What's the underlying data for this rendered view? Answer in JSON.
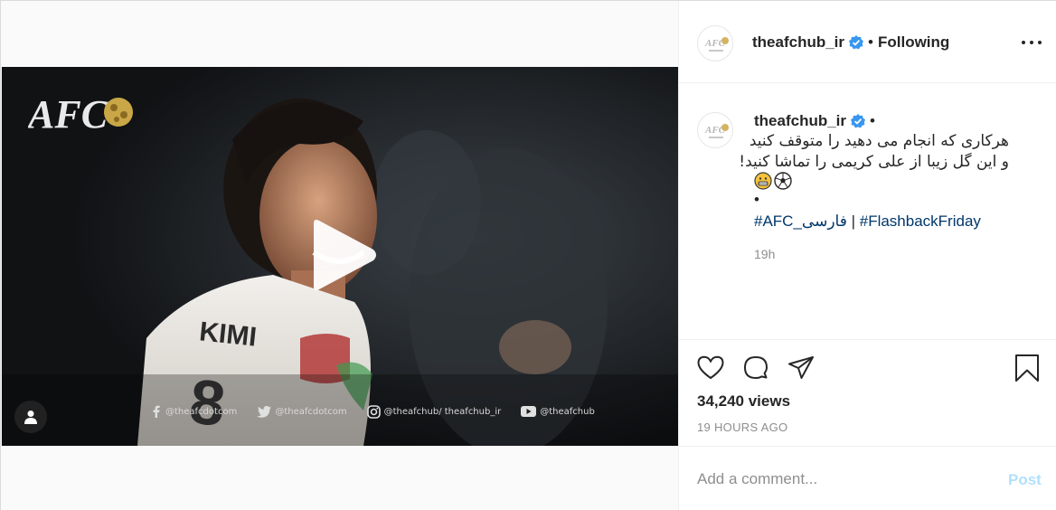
{
  "colors": {
    "text": "#262626",
    "muted": "#8e8e8e",
    "link": "#00376b",
    "verified_badge": "#3897f0",
    "post_button_disabled": "#b2dffc",
    "border": "#dbdbdb"
  },
  "video": {
    "overlay_logo": "AFC",
    "player_name": "KIMI",
    "jersey_number": "8",
    "social_handles": [
      {
        "icon": "facebook-icon",
        "text": "@theafcdotcom"
      },
      {
        "icon": "twitter-icon",
        "text": "@theafcdotcom"
      },
      {
        "icon": "instagram-icon",
        "text": "@theafchub/ theafchub_ir"
      },
      {
        "icon": "youtube-icon",
        "text": "@theafchub"
      }
    ]
  },
  "header": {
    "username": "theafchub_ir",
    "separator": "•",
    "follow_status": "Following"
  },
  "caption": {
    "username": "theafchub_ir",
    "separator": "•",
    "line1": "هرکاری که انجام می دهید را متوقف کنید",
    "line2": "و این گل زیبا از علی کریمی را تماشا کنید!",
    "emojis": [
      "grinning-face-icon",
      "soccer-ball-icon"
    ],
    "bullet": "•",
    "tag1": "#AFC_فارسی",
    "tag_separator": " | ",
    "tag2": "#FlashbackFriday",
    "time": "19h"
  },
  "stats": {
    "views": "34,240 views",
    "age": "19 HOURS AGO"
  },
  "comment": {
    "placeholder": "Add a comment...",
    "post_label": "Post"
  }
}
